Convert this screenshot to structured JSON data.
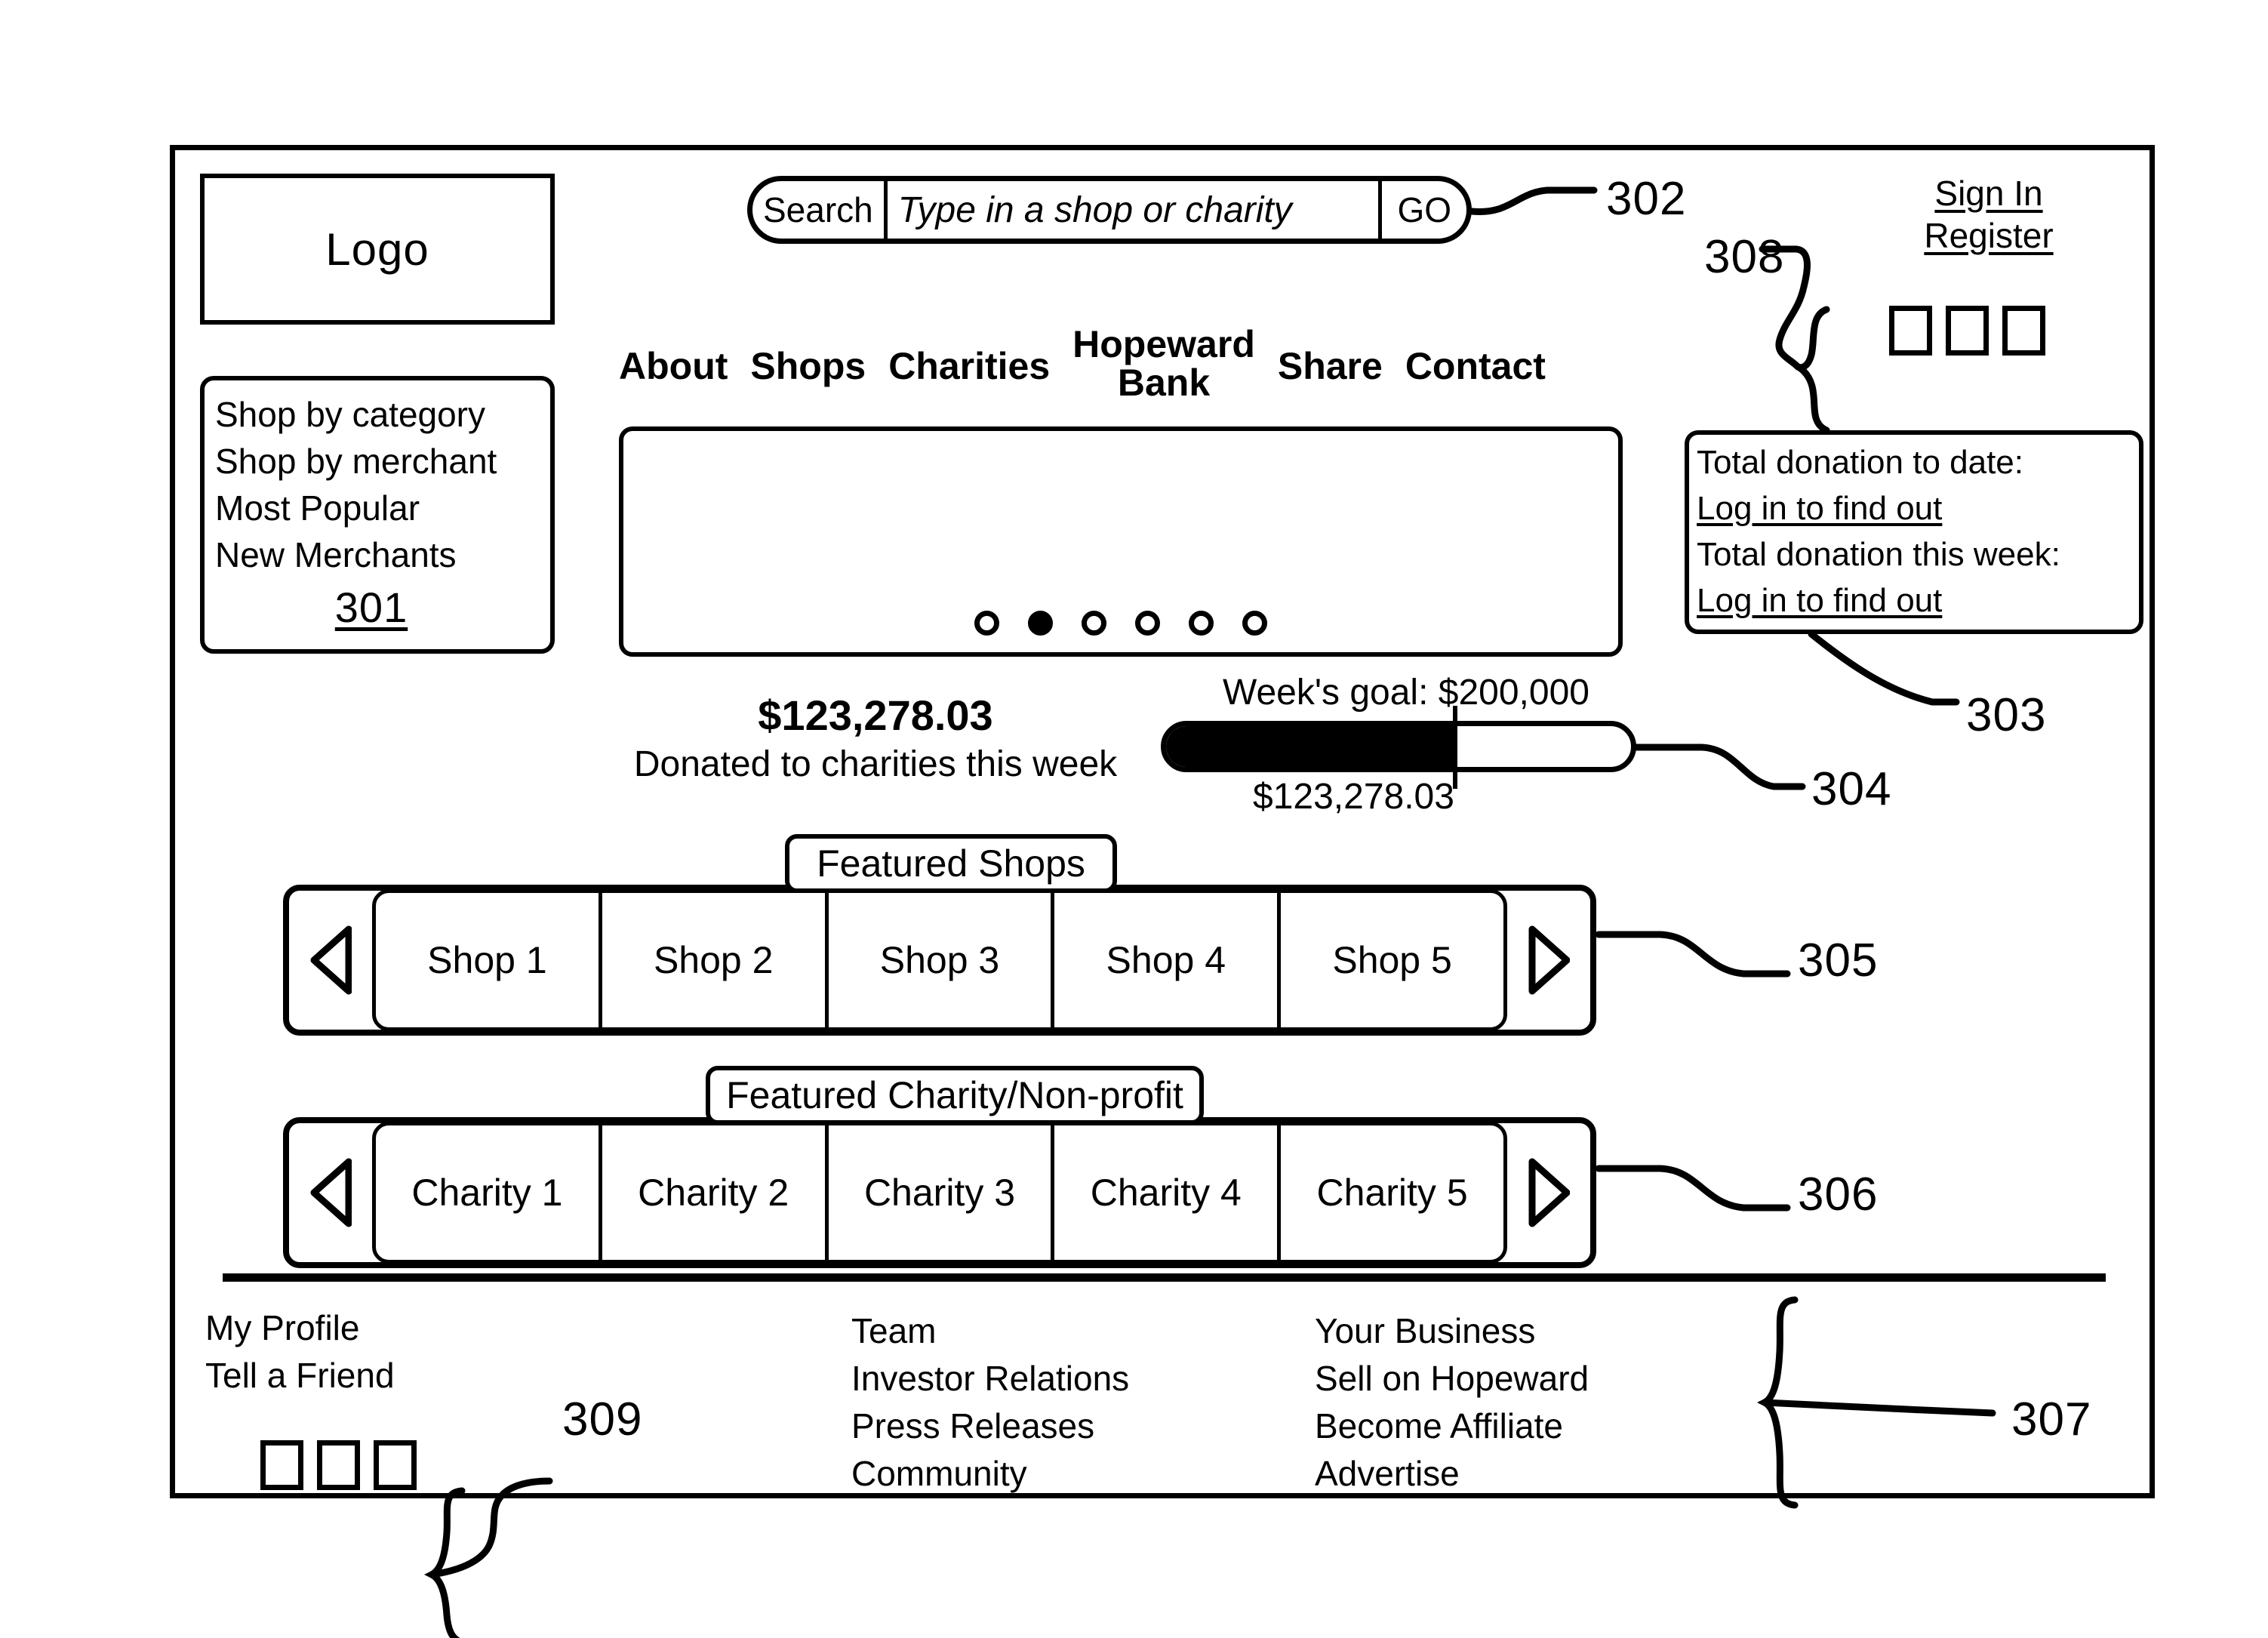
{
  "figure": {
    "type": "patent-wireframe",
    "reference_numerals": [
      {
        "id": "301",
        "label": "301"
      },
      {
        "id": "302",
        "label": "302"
      },
      {
        "id": "303",
        "label": "303"
      },
      {
        "id": "304",
        "label": "304"
      },
      {
        "id": "305",
        "label": "305"
      },
      {
        "id": "306",
        "label": "306"
      },
      {
        "id": "307",
        "label": "307"
      },
      {
        "id": "308",
        "label": "308"
      },
      {
        "id": "309",
        "label": "309"
      }
    ]
  },
  "logo": {
    "label": "Logo"
  },
  "sidebar": {
    "items": [
      {
        "label": "Shop by category"
      },
      {
        "label": "Shop by merchant"
      },
      {
        "label": "Most Popular"
      },
      {
        "label": "New Merchants"
      }
    ],
    "ref": "301"
  },
  "search": {
    "label": "Search",
    "placeholder": "Type in a shop or charity",
    "value": "",
    "go_label": "GO",
    "ref": "302"
  },
  "topnav": {
    "items": [
      {
        "label": "About",
        "lines": [
          "About"
        ]
      },
      {
        "label": "Shops",
        "lines": [
          "Shops"
        ]
      },
      {
        "label": "Charities",
        "lines": [
          "Charities"
        ]
      },
      {
        "label": "Hopeward Bank",
        "lines": [
          "Hopeward",
          "Bank"
        ]
      },
      {
        "label": "Share",
        "lines": [
          "Share"
        ]
      },
      {
        "label": "Contact",
        "lines": [
          "Contact"
        ]
      }
    ]
  },
  "account": {
    "sign_in_label": "Sign In",
    "register_label": "Register",
    "social_icons": [
      "social-square-icon",
      "social-square-icon",
      "social-square-icon"
    ],
    "ref": "308"
  },
  "donation_panel": {
    "to_date_label": "Total donation to date:",
    "to_date_value": "Log in to find out",
    "this_week_label": "Total donation this week:",
    "this_week_value": "Log in to find out",
    "ref": "303"
  },
  "banner": {
    "dots": 6,
    "active_dot_index": 1
  },
  "donation_summary": {
    "amount": "$123,278.03",
    "caption": "Donated to charities this week"
  },
  "progress": {
    "goal_label": "Week's goal: $200,000",
    "current_value": "$123,278.03",
    "percent": 62,
    "ref": "304"
  },
  "featured_shops": {
    "tab_label": "Featured Shops",
    "prev_icon": "triangle-left-icon",
    "next_icon": "triangle-right-icon",
    "cells": [
      {
        "label": "Shop 1"
      },
      {
        "label": "Shop 2"
      },
      {
        "label": "Shop 3"
      },
      {
        "label": "Shop 4"
      },
      {
        "label": "Shop 5"
      }
    ],
    "ref": "305"
  },
  "featured_charities": {
    "tab_label": "Featured Charity/Non-profit",
    "prev_icon": "triangle-left-icon",
    "next_icon": "triangle-right-icon",
    "cells": [
      {
        "label": "Charity 1"
      },
      {
        "label": "Charity 2"
      },
      {
        "label": "Charity 3"
      },
      {
        "label": "Charity 4"
      },
      {
        "label": "Charity 5"
      }
    ],
    "ref": "306"
  },
  "footer": {
    "column1": [
      {
        "label": "My Profile"
      },
      {
        "label": "Tell a Friend"
      }
    ],
    "column1_social_icons": [
      "social-square-icon",
      "social-square-icon",
      "social-square-icon"
    ],
    "column1_ref": "309",
    "column2": [
      {
        "label": "Team"
      },
      {
        "label": "Investor Relations"
      },
      {
        "label": "Press Releases"
      },
      {
        "label": "Community"
      }
    ],
    "column3": [
      {
        "label": "Your Business"
      },
      {
        "label": "Sell on Hopeward"
      },
      {
        "label": "Become Affiliate"
      },
      {
        "label": "Advertise"
      }
    ],
    "ref": "307"
  },
  "colors": {
    "ink": "#000000",
    "paper": "#ffffff"
  }
}
